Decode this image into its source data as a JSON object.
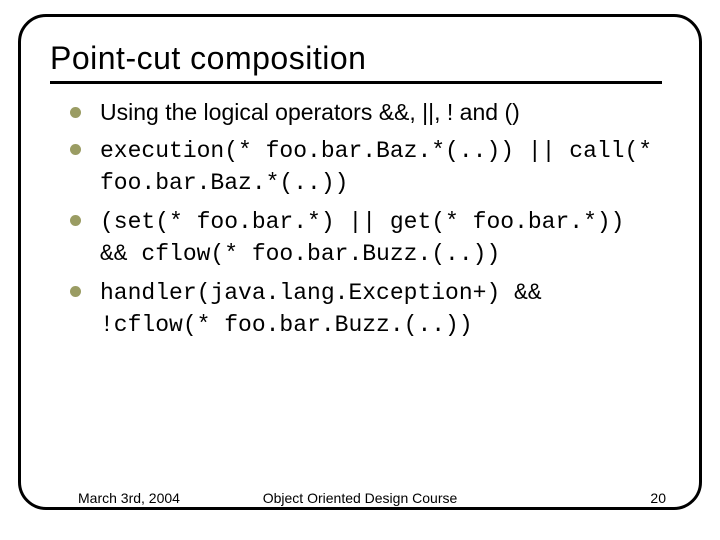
{
  "slide": {
    "title": "Point-cut composition",
    "bullets": [
      {
        "text": "Using the logical operators &&, ||, ! and ()",
        "code": false
      },
      {
        "text": "execution(* foo.bar.Baz.*(..)) || call(* foo.bar.Baz.*(..))",
        "code": true
      },
      {
        "text": "(set(* foo.bar.*) || get(* foo.bar.*)) && cflow(* foo.bar.Buzz.(..))",
        "code": true
      },
      {
        "text": "handler(java.lang.Exception+) && !cflow(* foo.bar.Buzz.(..))",
        "code": true
      }
    ],
    "footer": {
      "date": "March 3rd, 2004",
      "course": "Object Oriented Design Course",
      "page": "20"
    }
  }
}
